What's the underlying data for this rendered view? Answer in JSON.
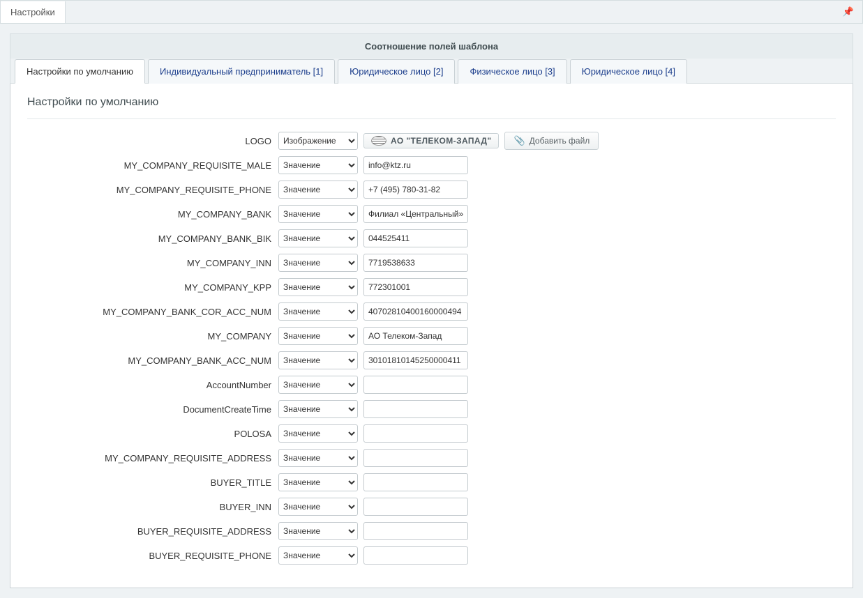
{
  "header": {
    "tab_label": "Настройки",
    "pin_icon": "📌"
  },
  "section": {
    "title": "Соотношение полей шаблона"
  },
  "tabs": [
    {
      "label": "Настройки по умолчанию",
      "active": true
    },
    {
      "label": "Индивидуальный предприниматель [1]",
      "active": false
    },
    {
      "label": "Юридическое лицо [2]",
      "active": false
    },
    {
      "label": "Физическое лицо [3]",
      "active": false
    },
    {
      "label": "Юридическое лицо [4]",
      "active": false
    }
  ],
  "content": {
    "heading": "Настройки по умолчанию"
  },
  "select_options": {
    "value": "Значение",
    "image": "Изображение"
  },
  "logo_row": {
    "label": "LOGO",
    "select_value": "Изображение",
    "logo_text": "АО \"ТЕЛЕКОМ-ЗАПАД\"",
    "add_file_label": "Добавить файл"
  },
  "fields": [
    {
      "label": "MY_COMPANY_REQUISITE_MALE",
      "select": "Значение",
      "value": "info@ktz.ru"
    },
    {
      "label": "MY_COMPANY_REQUISITE_PHONE",
      "select": "Значение",
      "value": "+7 (495) 780-31-82"
    },
    {
      "label": "MY_COMPANY_BANK",
      "select": "Значение",
      "value": "Филиал «Центральный» Ба"
    },
    {
      "label": "MY_COMPANY_BANK_BIK",
      "select": "Значение",
      "value": "044525411"
    },
    {
      "label": "MY_COMPANY_INN",
      "select": "Значение",
      "value": "7719538633"
    },
    {
      "label": "MY_COMPANY_KPP",
      "select": "Значение",
      "value": "772301001"
    },
    {
      "label": "MY_COMPANY_BANK_COR_ACC_NUM",
      "select": "Значение",
      "value": "40702810400160000494"
    },
    {
      "label": "MY_COMPANY",
      "select": "Значение",
      "value": "АО Телеком-Запад"
    },
    {
      "label": "MY_COMPANY_BANK_ACC_NUM",
      "select": "Значение",
      "value": "30101810145250000411"
    },
    {
      "label": "AccountNumber",
      "select": "Значение",
      "value": ""
    },
    {
      "label": "DocumentCreateTime",
      "select": "Значение",
      "value": ""
    },
    {
      "label": "POLOSA",
      "select": "Значение",
      "value": ""
    },
    {
      "label": "MY_COMPANY_REQUISITE_ADDRESS",
      "select": "Значение",
      "value": ""
    },
    {
      "label": "BUYER_TITLE",
      "select": "Значение",
      "value": ""
    },
    {
      "label": "BUYER_INN",
      "select": "Значение",
      "value": ""
    },
    {
      "label": "BUYER_REQUISITE_ADDRESS",
      "select": "Значение",
      "value": ""
    },
    {
      "label": "BUYER_REQUISITE_PHONE",
      "select": "Значение",
      "value": ""
    }
  ]
}
